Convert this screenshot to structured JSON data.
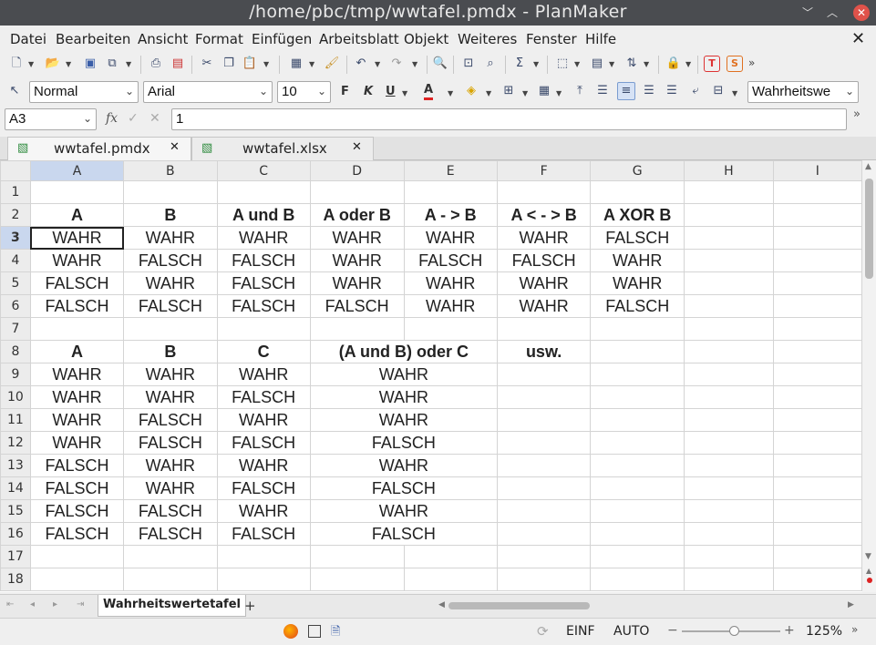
{
  "window": {
    "title": "/home/pbc/tmp/wwtafel.pmdx - PlanMaker"
  },
  "menu": [
    {
      "label": "Datei"
    },
    {
      "label": "Bearbeiten"
    },
    {
      "label": "Ansicht"
    },
    {
      "label": "Format"
    },
    {
      "label": "Einfügen"
    },
    {
      "label": "Arbeitsblatt"
    },
    {
      "label": "Objekt"
    },
    {
      "label": "Weiteres"
    },
    {
      "label": "Fenster"
    },
    {
      "label": "Hilfe"
    }
  ],
  "format_bar": {
    "style": "Normal",
    "font": "Arial",
    "size": "10",
    "bold": "F",
    "italic": "K",
    "underline": "U",
    "text_color": "A",
    "stylebox": "Wahrheitswe"
  },
  "formula_bar": {
    "cell_ref": "A3",
    "fx": "fx",
    "content": "1"
  },
  "doc_tabs": [
    {
      "label": "wwtafel.pmdx",
      "active": true
    },
    {
      "label": "wwtafel.xlsx",
      "active": false
    }
  ],
  "grid": {
    "columns": [
      "A",
      "B",
      "C",
      "D",
      "E",
      "F",
      "G",
      "H",
      "I"
    ],
    "selected_col": "A",
    "selected_row": 3,
    "rows": [
      {
        "n": "1",
        "c": [
          "",
          "",
          "",
          "",
          "",
          "",
          "",
          "",
          ""
        ]
      },
      {
        "n": "2",
        "c": [
          "A",
          "B",
          "A und B",
          "A oder B",
          "A - > B",
          "A < - > B",
          "A XOR B",
          "",
          ""
        ]
      },
      {
        "n": "3",
        "c": [
          "WAHR",
          "WAHR",
          "WAHR",
          "WAHR",
          "WAHR",
          "WAHR",
          "FALSCH",
          "",
          ""
        ]
      },
      {
        "n": "4",
        "c": [
          "WAHR",
          "FALSCH",
          "FALSCH",
          "WAHR",
          "FALSCH",
          "FALSCH",
          "WAHR",
          "",
          ""
        ]
      },
      {
        "n": "5",
        "c": [
          "FALSCH",
          "WAHR",
          "FALSCH",
          "WAHR",
          "WAHR",
          "WAHR",
          "WAHR",
          "",
          ""
        ]
      },
      {
        "n": "6",
        "c": [
          "FALSCH",
          "FALSCH",
          "FALSCH",
          "FALSCH",
          "WAHR",
          "WAHR",
          "FALSCH",
          "",
          ""
        ]
      },
      {
        "n": "7",
        "c": [
          "",
          "",
          "",
          "",
          "",
          "",
          "",
          "",
          ""
        ]
      },
      {
        "n": "8",
        "c": [
          "A",
          "B",
          "C",
          "(A und B) oder C",
          "",
          "usw.",
          "",
          "",
          ""
        ]
      },
      {
        "n": "9",
        "c": [
          "WAHR",
          "WAHR",
          "WAHR",
          "WAHR",
          "",
          "",
          "",
          "",
          ""
        ]
      },
      {
        "n": "10",
        "c": [
          "WAHR",
          "WAHR",
          "FALSCH",
          "WAHR",
          "",
          "",
          "",
          "",
          ""
        ]
      },
      {
        "n": "11",
        "c": [
          "WAHR",
          "FALSCH",
          "WAHR",
          "WAHR",
          "",
          "",
          "",
          "",
          ""
        ]
      },
      {
        "n": "12",
        "c": [
          "WAHR",
          "FALSCH",
          "FALSCH",
          "FALSCH",
          "",
          "",
          "",
          "",
          ""
        ]
      },
      {
        "n": "13",
        "c": [
          "FALSCH",
          "WAHR",
          "WAHR",
          "WAHR",
          "",
          "",
          "",
          "",
          ""
        ]
      },
      {
        "n": "14",
        "c": [
          "FALSCH",
          "WAHR",
          "FALSCH",
          "FALSCH",
          "",
          "",
          "",
          "",
          ""
        ]
      },
      {
        "n": "15",
        "c": [
          "FALSCH",
          "FALSCH",
          "WAHR",
          "WAHR",
          "",
          "",
          "",
          "",
          ""
        ]
      },
      {
        "n": "16",
        "c": [
          "FALSCH",
          "FALSCH",
          "FALSCH",
          "FALSCH",
          "",
          "",
          "",
          "",
          ""
        ]
      },
      {
        "n": "17",
        "c": [
          "",
          "",
          "",
          "",
          "",
          "",
          "",
          "",
          ""
        ]
      },
      {
        "n": "18",
        "c": [
          "",
          "",
          "",
          "",
          "",
          "",
          "",
          "",
          ""
        ]
      }
    ]
  },
  "sheet_tabs": [
    {
      "label": "Wahrheitswertetafel"
    }
  ],
  "sheet_add": "+",
  "status": {
    "mode": "EINF",
    "calc": "AUTO",
    "zoom": "125%"
  }
}
